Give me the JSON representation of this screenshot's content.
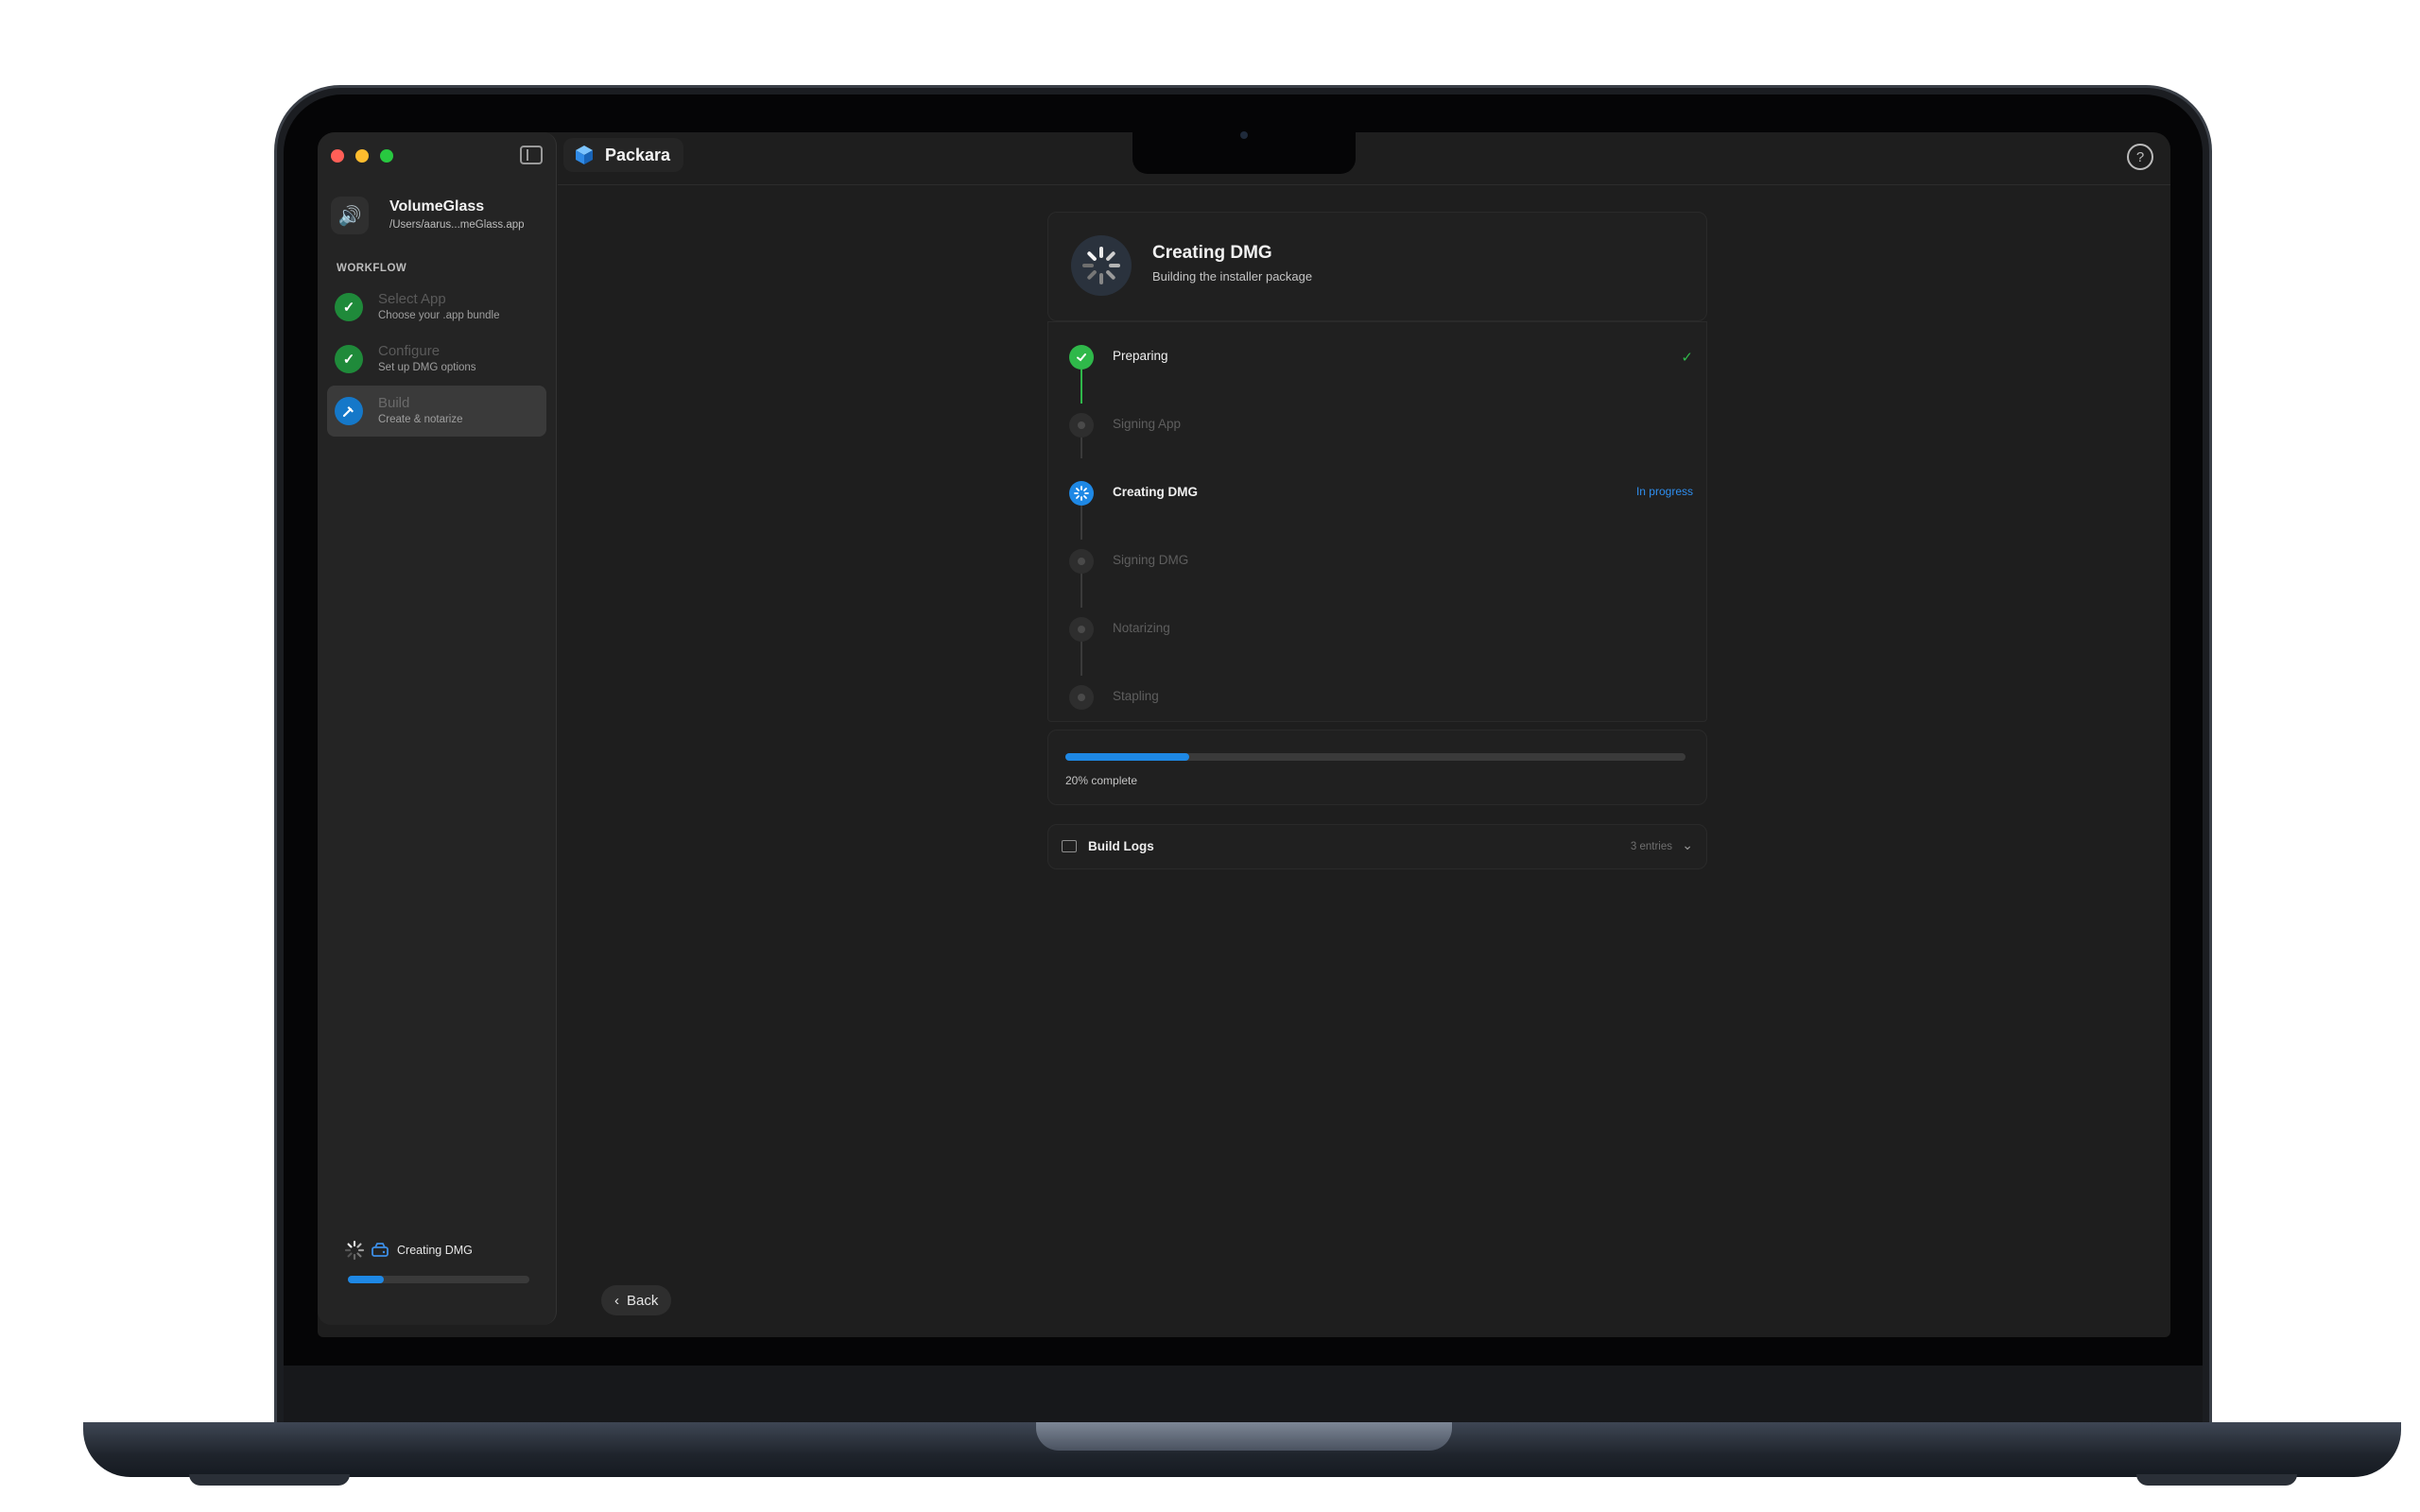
{
  "window": {
    "title": "Packara",
    "help_icon": "question-icon"
  },
  "sidebar": {
    "app_name": "VolumeGlass",
    "app_path": "/Users/aarus...meGlass.app",
    "section_label": "WORKFLOW",
    "steps": [
      {
        "title": "Select App",
        "subtitle": "Choose your .app bundle",
        "state": "done"
      },
      {
        "title": "Configure",
        "subtitle": "Set up DMG options",
        "state": "done"
      },
      {
        "title": "Build",
        "subtitle": "Create & notarize",
        "state": "active"
      }
    ],
    "status_label": "Creating DMG",
    "status_progress": 0.2
  },
  "main": {
    "header_title": "Creating DMG",
    "header_subtitle": "Building the installer package",
    "steps": [
      {
        "label": "Preparing",
        "status": "✓",
        "state": "done"
      },
      {
        "label": "Signing App",
        "status": "",
        "state": "pending"
      },
      {
        "label": "Creating DMG",
        "status": "In progress",
        "state": "active"
      },
      {
        "label": "Signing DMG",
        "status": "",
        "state": "pending"
      },
      {
        "label": "Notarizing",
        "status": "",
        "state": "pending"
      },
      {
        "label": "Stapling",
        "status": "",
        "state": "pending"
      }
    ],
    "progress_value": 0.2,
    "progress_label": "20% complete",
    "logs_title": "Build Logs",
    "logs_count": "3 entries",
    "back_label": "Back"
  },
  "colors": {
    "accent": "#1e88e5",
    "success": "#2fb84a",
    "background": "#1e1e1e"
  }
}
